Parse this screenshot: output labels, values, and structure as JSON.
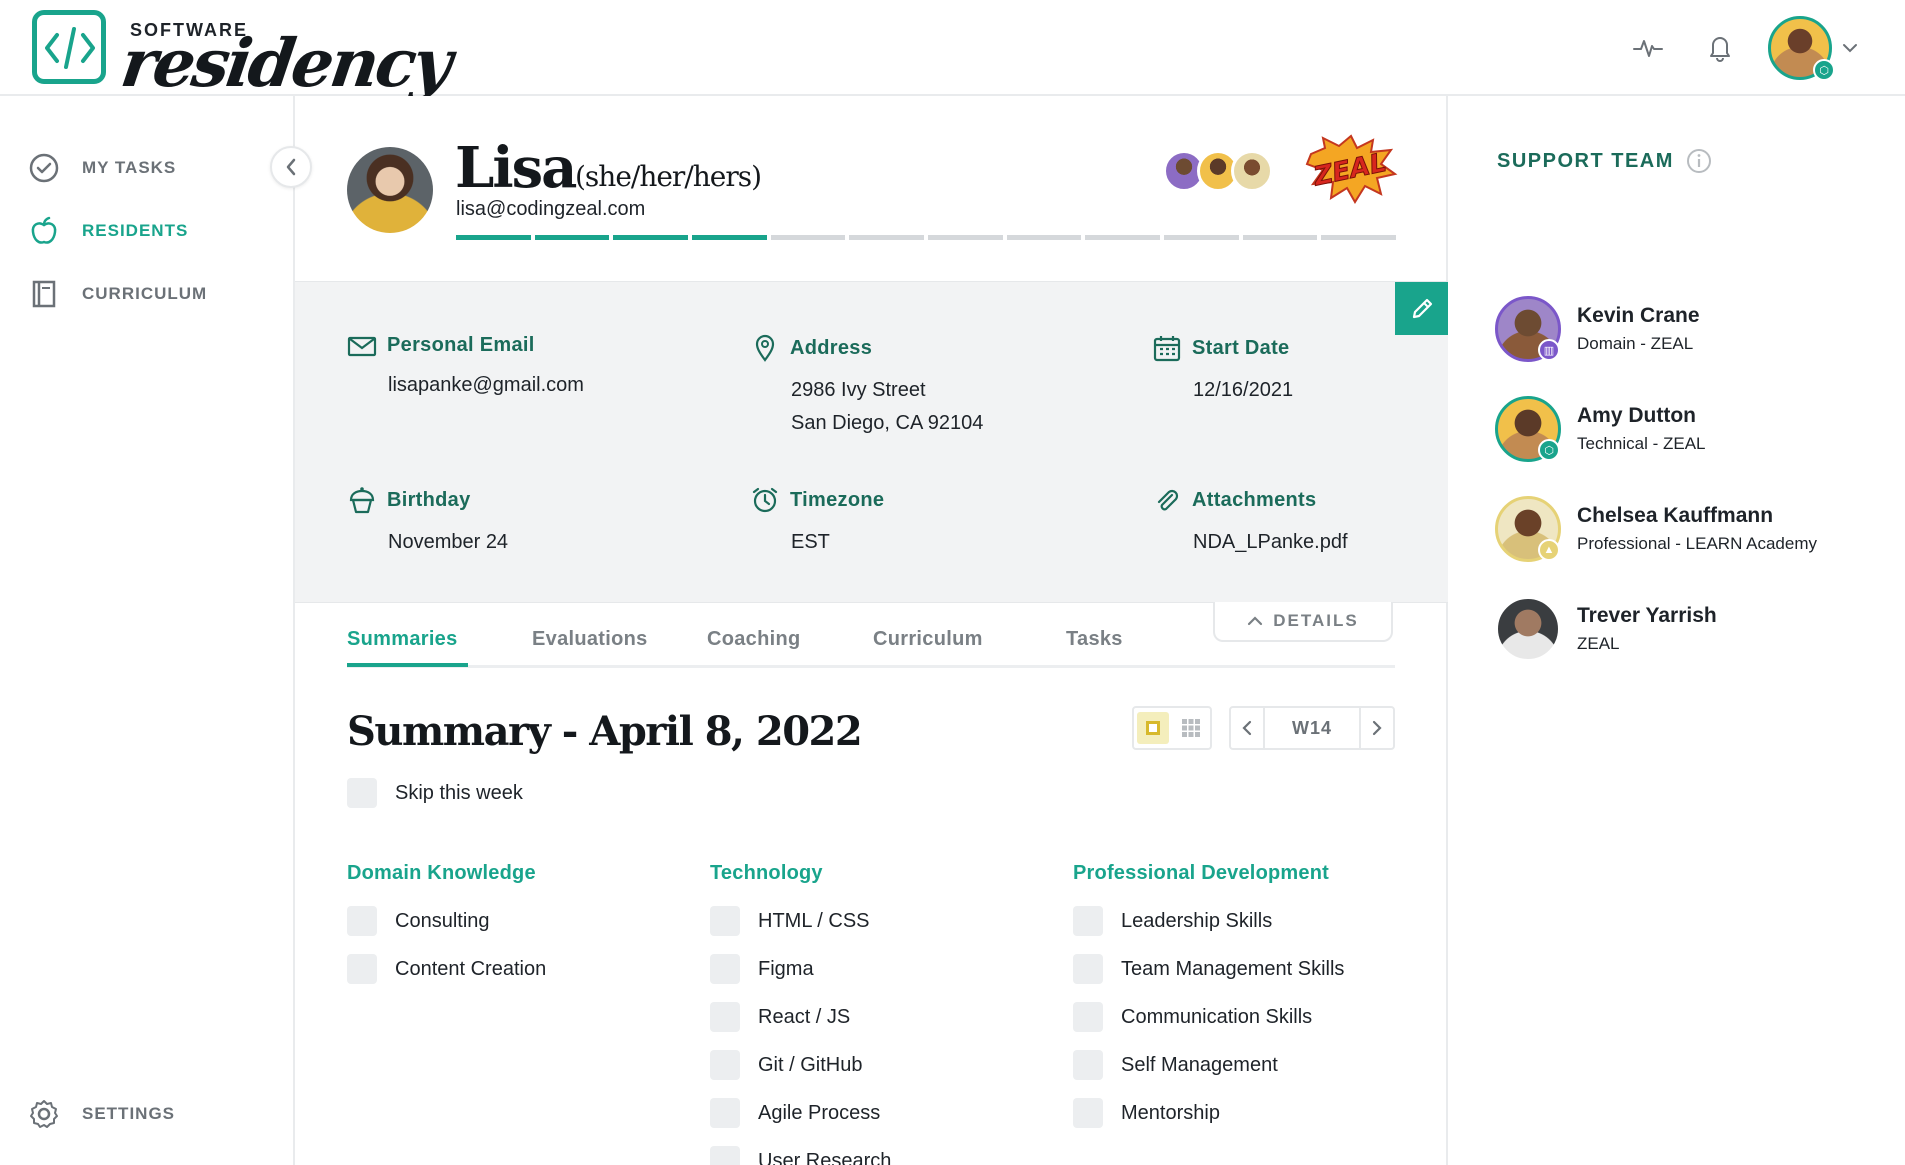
{
  "brand": {
    "small": "SOFTWARE",
    "script": "residency"
  },
  "header": {
    "icons": [
      "activity-icon",
      "bell-icon"
    ],
    "user_badge": "cube-icon"
  },
  "sidebar": {
    "items": [
      {
        "label": "MY TASKS",
        "icon": "check-circle-icon",
        "active": false
      },
      {
        "label": "RESIDENTS",
        "icon": "apple-icon",
        "active": true
      },
      {
        "label": "CURRICULUM",
        "icon": "book-icon",
        "active": false
      }
    ],
    "settings_label": "SETTINGS"
  },
  "profile": {
    "name": "Lisa",
    "pronouns": "(she/her/hers)",
    "email": "lisa@codingzeal.com",
    "progress": {
      "completed": 4,
      "total": 12
    },
    "badge_text": "ZEAL"
  },
  "info": {
    "personal_email": {
      "label": "Personal Email",
      "value": "lisapanke@gmail.com"
    },
    "address": {
      "label": "Address",
      "line1": "2986 Ivy Street",
      "line2": "San Diego, CA 92104"
    },
    "start_date": {
      "label": "Start Date",
      "value": "12/16/2021"
    },
    "birthday": {
      "label": "Birthday",
      "value": "November 24"
    },
    "timezone": {
      "label": "Timezone",
      "value": "EST"
    },
    "attachments": {
      "label": "Attachments",
      "value": "NDA_LPanke.pdf"
    }
  },
  "tabs": [
    "Summaries",
    "Evaluations",
    "Coaching",
    "Curriculum",
    "Tasks"
  ],
  "active_tab": "Summaries",
  "details_label": "DETAILS",
  "summary": {
    "title": "Summary - April 8, 2022",
    "week": "W14",
    "skip_label": "Skip this week",
    "columns": [
      {
        "title": "Domain Knowledge",
        "items": [
          "Consulting",
          "Content Creation"
        ]
      },
      {
        "title": "Technology",
        "items": [
          "HTML / CSS",
          "Figma",
          "React / JS",
          "Git / GitHub",
          "Agile Process",
          "User Research"
        ]
      },
      {
        "title": "Professional Development",
        "items": [
          "Leadership Skills",
          "Team Management Skills",
          "Communication Skills",
          "Self Management",
          "Mentorship"
        ]
      }
    ]
  },
  "support_team": {
    "title": "SUPPORT TEAM",
    "members": [
      {
        "name": "Kevin Crane",
        "role": "Domain - ZEAL",
        "ring": "#7b57c9",
        "badge": "book-icon"
      },
      {
        "name": "Amy Dutton",
        "role": "Technical - ZEAL",
        "ring": "#19a48c",
        "badge": "cube-icon"
      },
      {
        "name": "Chelsea Kauffmann",
        "role": "Professional - LEARN Academy",
        "ring": "#e6d276",
        "badge": "rocket-icon"
      },
      {
        "name": "Trever Yarrish",
        "role": "ZEAL",
        "ring": "#ffffff",
        "badge": ""
      }
    ]
  },
  "colors": {
    "accent": "#19a48c",
    "accent_dark": "#1b6b5a",
    "panel_bg": "#f2f3f4"
  }
}
